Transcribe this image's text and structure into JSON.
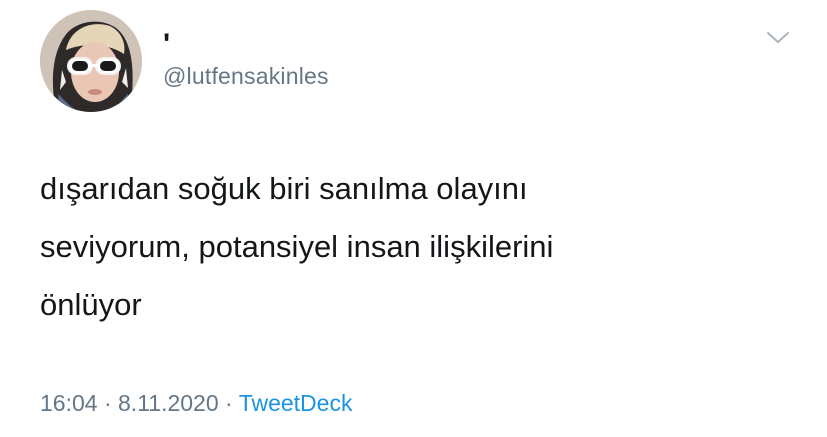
{
  "tweet": {
    "display_name": "'",
    "handle": "@lutfensakinles",
    "text_lines": [
      "dışarıdan soğuk biri sanılma olayını",
      "seviyorum, potansiyel insan ilişkilerini",
      "önlüyor"
    ],
    "time": "16:04",
    "separator": "·",
    "date": "8.11.2020",
    "source": "TweetDeck"
  },
  "icons": {
    "menu": "chevron-down-icon",
    "avatar": "profile-photo"
  },
  "colors": {
    "text": "#14171a",
    "secondary": "#657786",
    "link": "#1b95e0",
    "background": "#ffffff"
  }
}
